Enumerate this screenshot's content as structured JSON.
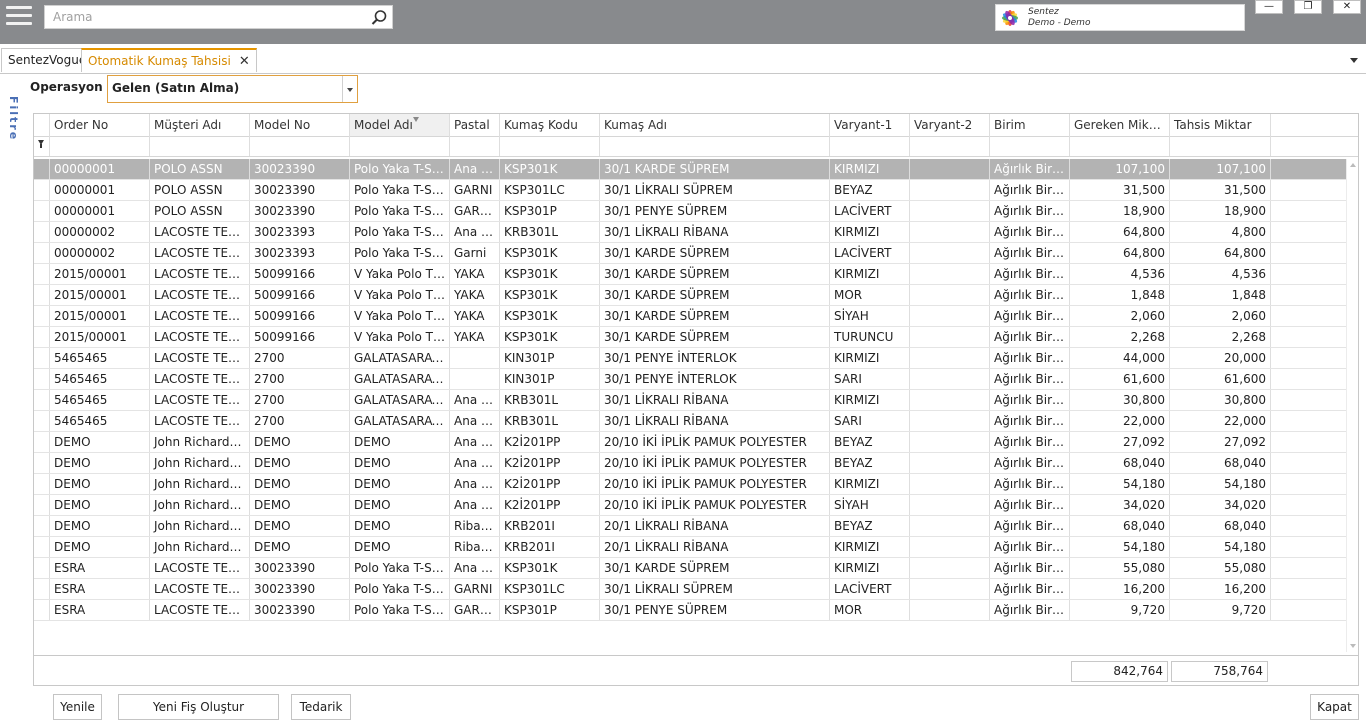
{
  "search": {
    "placeholder": "Arama"
  },
  "logo": {
    "line1": "Sentez",
    "line2": "Demo - Demo"
  },
  "window": {
    "minimize": "—",
    "restore": "❐",
    "close": "✕"
  },
  "tabs": [
    {
      "label": "SentezVogue"
    },
    {
      "label": "Otomatik Kumaş Tahsisi",
      "close": "✕"
    }
  ],
  "filter_side_label": "Filtre",
  "operasyon": {
    "label": "Operasyon",
    "value": "Gelen (Satın Alma)"
  },
  "grid": {
    "columns": [
      "Order No",
      "Müşteri Adı",
      "Model No",
      "Model Adı",
      "Pastal",
      "Kumaş Kodu",
      "Kumaş Adı",
      "Varyant-1",
      "Varyant-2",
      "Birim",
      "Gereken Miktar",
      "Tahsis Miktar"
    ],
    "rows": [
      [
        "00000001",
        "POLO ASSN",
        "30023390",
        "Polo Yaka T-Shirt",
        "Ana K...",
        "KSP301K",
        "30/1 KARDE SÜPREM",
        "KIRMIZI",
        "",
        "Ağırlık Biri...",
        "107,100",
        "107,100"
      ],
      [
        "00000001",
        "POLO ASSN",
        "30023390",
        "Polo Yaka T-Shirt",
        "GARNI",
        "KSP301LC",
        "30/1 LİKRALI SÜPREM",
        "BEYAZ",
        "",
        "Ağırlık Biri...",
        "31,500",
        "31,500"
      ],
      [
        "00000001",
        "POLO ASSN",
        "30023390",
        "Polo Yaka T-Shirt",
        "GARN...",
        "KSP301P",
        "30/1 PENYE SÜPREM",
        "LACİVERT",
        "",
        "Ağırlık Biri...",
        "18,900",
        "18,900"
      ],
      [
        "00000002",
        "LACOSTE TEX....",
        "30023393",
        "Polo Yaka T-Shirt",
        "Ana K...",
        "KRB301L",
        "30/1 LİKRALI RİBANA",
        "KIRMIZI",
        "",
        "Ağırlık Biri...",
        "64,800",
        "4,800"
      ],
      [
        "00000002",
        "LACOSTE TEX....",
        "30023393",
        "Polo Yaka T-Shirt",
        "Garni",
        "KSP301K",
        "30/1 KARDE SÜPREM",
        "LACİVERT",
        "",
        "Ağırlık Biri...",
        "64,800",
        "64,800"
      ],
      [
        "2015/00001",
        "LACOSTE TEX....",
        "50099166",
        "V Yaka Polo T S...",
        "YAKA",
        "KSP301K",
        "30/1 KARDE SÜPREM",
        "KIRMIZI",
        "",
        "Ağırlık Biri...",
        "4,536",
        "4,536"
      ],
      [
        "2015/00001",
        "LACOSTE TEX....",
        "50099166",
        "V Yaka Polo T S...",
        "YAKA",
        "KSP301K",
        "30/1 KARDE SÜPREM",
        "MOR",
        "",
        "Ağırlık Biri...",
        "1,848",
        "1,848"
      ],
      [
        "2015/00001",
        "LACOSTE TEX....",
        "50099166",
        "V Yaka Polo T S...",
        "YAKA",
        "KSP301K",
        "30/1 KARDE SÜPREM",
        "SİYAH",
        "",
        "Ağırlık Biri...",
        "2,060",
        "2,060"
      ],
      [
        "2015/00001",
        "LACOSTE TEX....",
        "50099166",
        "V Yaka Polo T S...",
        "YAKA",
        "KSP301K",
        "30/1 KARDE SÜPREM",
        "TURUNCU",
        "",
        "Ağırlık Biri...",
        "2,268",
        "2,268"
      ],
      [
        "5465465",
        "LACOSTE TEX....",
        "2700",
        "GALATASARAY...",
        "",
        "KIN301P",
        "30/1 PENYE İNTERLOK",
        "KIRMIZI",
        "",
        "Ağırlık Biri...",
        "44,000",
        "20,000"
      ],
      [
        "5465465",
        "LACOSTE TEX....",
        "2700",
        "GALATASARAY...",
        "",
        "KIN301P",
        "30/1 PENYE İNTERLOK",
        "SARI",
        "",
        "Ağırlık Biri...",
        "61,600",
        "61,600"
      ],
      [
        "5465465",
        "LACOSTE TEX....",
        "2700",
        "GALATASARAY...",
        "Ana K...",
        "KRB301L",
        "30/1 LİKRALI RİBANA",
        "KIRMIZI",
        "",
        "Ağırlık Biri...",
        "30,800",
        "30,800"
      ],
      [
        "5465465",
        "LACOSTE TEX....",
        "2700",
        "GALATASARAY...",
        "Ana K...",
        "KRB301L",
        "30/1 LİKRALI RİBANA",
        "SARI",
        "",
        "Ağırlık Biri...",
        "22,000",
        "22,000"
      ],
      [
        "DEMO",
        "John Richard G...",
        "DEMO",
        "DEMO",
        "Ana K...",
        "K2İ201PP",
        "20/10 İKİ İPLİK PAMUK POLYESTER",
        "BEYAZ",
        "",
        "Ağırlık Biri...",
        "27,092",
        "27,092"
      ],
      [
        "DEMO",
        "John Richard G...",
        "DEMO",
        "DEMO",
        "Ana K...",
        "K2İ201PP",
        "20/10 İKİ İPLİK PAMUK POLYESTER",
        "BEYAZ",
        "",
        "Ağırlık Biri...",
        "68,040",
        "68,040"
      ],
      [
        "DEMO",
        "John Richard G...",
        "DEMO",
        "DEMO",
        "Ana K...",
        "K2İ201PP",
        "20/10 İKİ İPLİK PAMUK POLYESTER",
        "KIRMIZI",
        "",
        "Ağırlık Biri...",
        "54,180",
        "54,180"
      ],
      [
        "DEMO",
        "John Richard G...",
        "DEMO",
        "DEMO",
        "Ana K...",
        "K2İ201PP",
        "20/10 İKİ İPLİK PAMUK POLYESTER",
        "SİYAH",
        "",
        "Ağırlık Biri...",
        "34,020",
        "34,020"
      ],
      [
        "DEMO",
        "John Richard G...",
        "DEMO",
        "DEMO",
        "Ribana",
        "KRB201I",
        "20/1 LİKRALI RİBANA",
        "BEYAZ",
        "",
        "Ağırlık Biri...",
        "68,040",
        "68,040"
      ],
      [
        "DEMO",
        "John Richard G...",
        "DEMO",
        "DEMO",
        "Ribana",
        "KRB201I",
        "20/1 LİKRALI RİBANA",
        "KIRMIZI",
        "",
        "Ağırlık Biri...",
        "54,180",
        "54,180"
      ],
      [
        "ESRA",
        "LACOSTE TEX....",
        "30023390",
        "Polo Yaka T-Shirt",
        "Ana K...",
        "KSP301K",
        "30/1 KARDE SÜPREM",
        "KIRMIZI",
        "",
        "Ağırlık Biri...",
        "55,080",
        "55,080"
      ],
      [
        "ESRA",
        "LACOSTE TEX....",
        "30023390",
        "Polo Yaka T-Shirt",
        "GARNI",
        "KSP301LC",
        "30/1 LİKRALI SÜPREM",
        "LACİVERT",
        "",
        "Ağırlık Biri...",
        "16,200",
        "16,200"
      ],
      [
        "ESRA",
        "LACOSTE TEX....",
        "30023390",
        "Polo Yaka T-Shirt",
        "GARN...",
        "KSP301P",
        "30/1 PENYE SÜPREM",
        "MOR",
        "",
        "Ağırlık Biri...",
        "9,720",
        "9,720"
      ]
    ],
    "selected_row": 0,
    "totals": {
      "gereken": "842,764",
      "tahsis": "758,764"
    }
  },
  "buttons": {
    "refresh": "Yenile",
    "new_slip": "Yeni Fiş Oluştur",
    "supply": "Tedarik",
    "close": "Kapat"
  },
  "colors": {
    "topbar": "#888a8d",
    "active_tab": "#d68a00",
    "selected_row": "#b3b3b3",
    "filter_label": "#4a6fb5"
  }
}
